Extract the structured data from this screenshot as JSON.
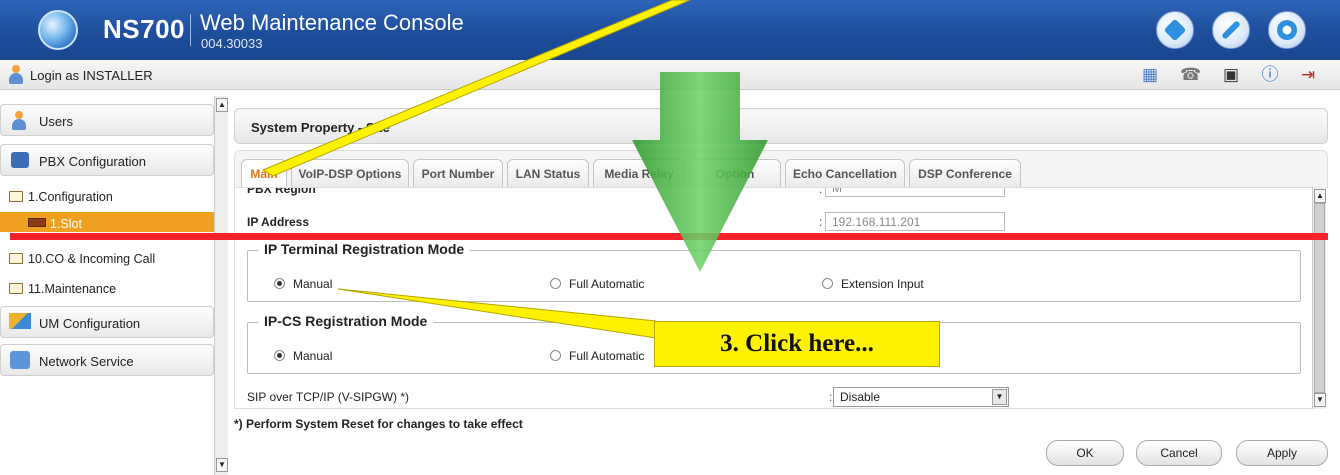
{
  "header": {
    "product": "NS700",
    "app_title": "Web Maintenance Console",
    "version": "004.30033",
    "buttons": [
      "home-icon",
      "edit-tools-icon",
      "settings-gear-icon"
    ]
  },
  "login": {
    "label": "Login as INSTALLER"
  },
  "toolbar_icons": [
    "calendar-icon",
    "phone-config-icon",
    "save-icon",
    "info-icon",
    "logout-icon"
  ],
  "sidebar": {
    "users": "Users",
    "pbx": "PBX Configuration",
    "config": "1.Configuration",
    "slot": "1.Slot",
    "co": "10.CO & Incoming Call",
    "maint": "11.Maintenance",
    "um": "UM Configuration",
    "net": "Network Service"
  },
  "page": {
    "title": "System Property - Site",
    "tabs": [
      "Main",
      "VoIP-DSP Options",
      "Port Number",
      "LAN Status",
      "Media Relay",
      "Option",
      "Echo Cancellation",
      "DSP Conference"
    ],
    "pbx_region_label": "PBX Region",
    "pbx_region_value": "M",
    "ip_label": "IP Address",
    "ip_value": "192.168.111.201",
    "ipt_group": "IP Terminal Registration Mode",
    "ipt_options": [
      "Manual",
      "Full Automatic",
      "Extension Input"
    ],
    "ipcs_group": "IP-CS Registration Mode",
    "ipcs_options": [
      "Manual",
      "Full Automatic"
    ],
    "sip_label": "SIP over TCP/IP (V-SIPGW) *)",
    "sip_value": "Disable",
    "note": "*) Perform System Reset for changes to take effect"
  },
  "buttons": {
    "ok": "OK",
    "cancel": "Cancel",
    "apply": "Apply"
  },
  "callout": "3. Click here...",
  "colors": {
    "accent": "#f0a020",
    "header": "#1e4e9c",
    "annotation_line": "#f4222b",
    "callout": "#fff200",
    "arrow": "#3aaa35"
  }
}
